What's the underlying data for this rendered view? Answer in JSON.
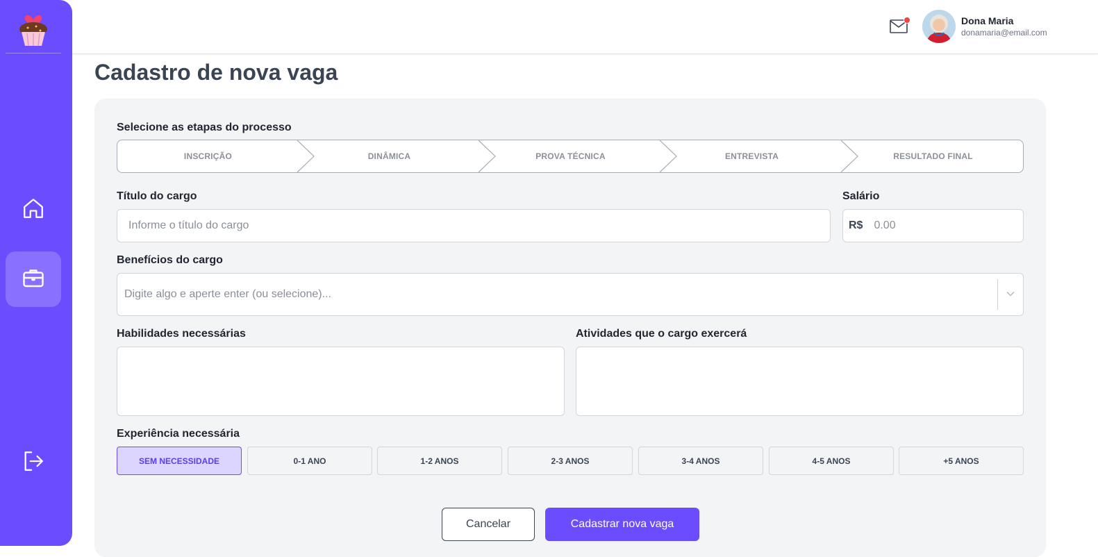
{
  "sidebar": {
    "logo": "cupcake-logo",
    "items": [
      {
        "name": "home",
        "icon": "home-icon",
        "active": false
      },
      {
        "name": "jobs",
        "icon": "briefcase-icon",
        "active": true
      },
      {
        "name": "logout",
        "icon": "logout-icon",
        "active": false
      }
    ],
    "accent_color": "#6c4cff"
  },
  "header": {
    "notification_icon": "mail-icon",
    "has_notification": true,
    "user": {
      "name": "Dona Maria",
      "email": "donamaria@email.com"
    }
  },
  "page": {
    "title": "Cadastro de nova vaga"
  },
  "form": {
    "steps_label": "Selecione as etapas do processo",
    "steps": [
      "INSCRIÇÃO",
      "DINÂMICA",
      "PROVA TÉCNICA",
      "ENTREVISTA",
      "RESULTADO FINAL"
    ],
    "job_title": {
      "label": "Título do cargo",
      "placeholder": "Informe o título do cargo"
    },
    "salary": {
      "label": "Salário",
      "prefix": "R$",
      "placeholder": "0.00"
    },
    "benefits": {
      "label": "Benefícios do cargo",
      "placeholder": "Digite algo e aperte enter (ou selecione)..."
    },
    "skills": {
      "label": "Habilidades necessárias"
    },
    "activities": {
      "label": "Atividades que o cargo exercerá"
    },
    "experience": {
      "label": "Experiência necessária",
      "options": [
        "SEM NECESSIDADE",
        "0-1 ANO",
        "1-2 ANOS",
        "2-3 ANOS",
        "3-4 ANOS",
        "4-5 ANOS",
        "+5 ANOS"
      ],
      "selected": "SEM NECESSIDADE"
    },
    "cancel_label": "Cancelar",
    "submit_label": "Cadastrar nova vaga"
  }
}
